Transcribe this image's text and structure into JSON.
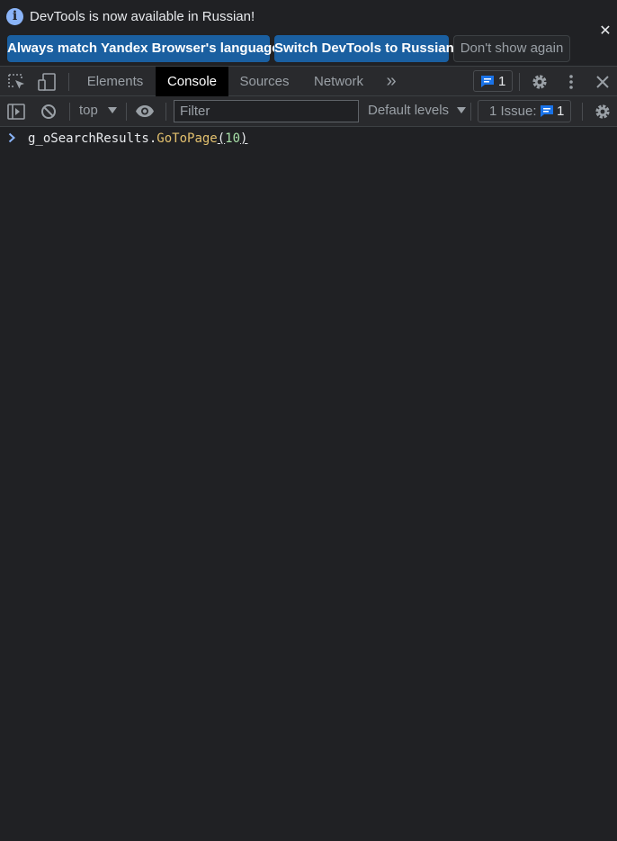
{
  "infobar": {
    "message": "DevTools is now available in Russian!",
    "info_icon": "info-icon",
    "buttons": {
      "match_language": "Always match Yandex Browser's language",
      "switch_language": "Switch DevTools to Russian",
      "dont_show": "Don't show again"
    },
    "close_glyph": "✕"
  },
  "tabs": {
    "items": [
      "Elements",
      "Console",
      "Sources",
      "Network"
    ],
    "active": "Console",
    "more_glyph": "»",
    "messages_badge_count": "1"
  },
  "console_toolbar": {
    "context": "top",
    "filter_placeholder": "Filter",
    "levels": "Default levels",
    "issues_label": "1 Issue:",
    "issues_count": "1"
  },
  "console": {
    "entries": [
      {
        "object": "g_oSearchResults",
        "dot": ".",
        "method": "GoToPage",
        "open_paren": "(",
        "argument": "10",
        "close_paren": ")"
      }
    ]
  },
  "colors": {
    "background": "#202124",
    "toolbar": "#292a2d",
    "primary_button": "#1a5fa0",
    "accent_blue": "#8ab4f8",
    "method_yellow": "#e2c06e",
    "number_green": "#a8e1a8"
  }
}
